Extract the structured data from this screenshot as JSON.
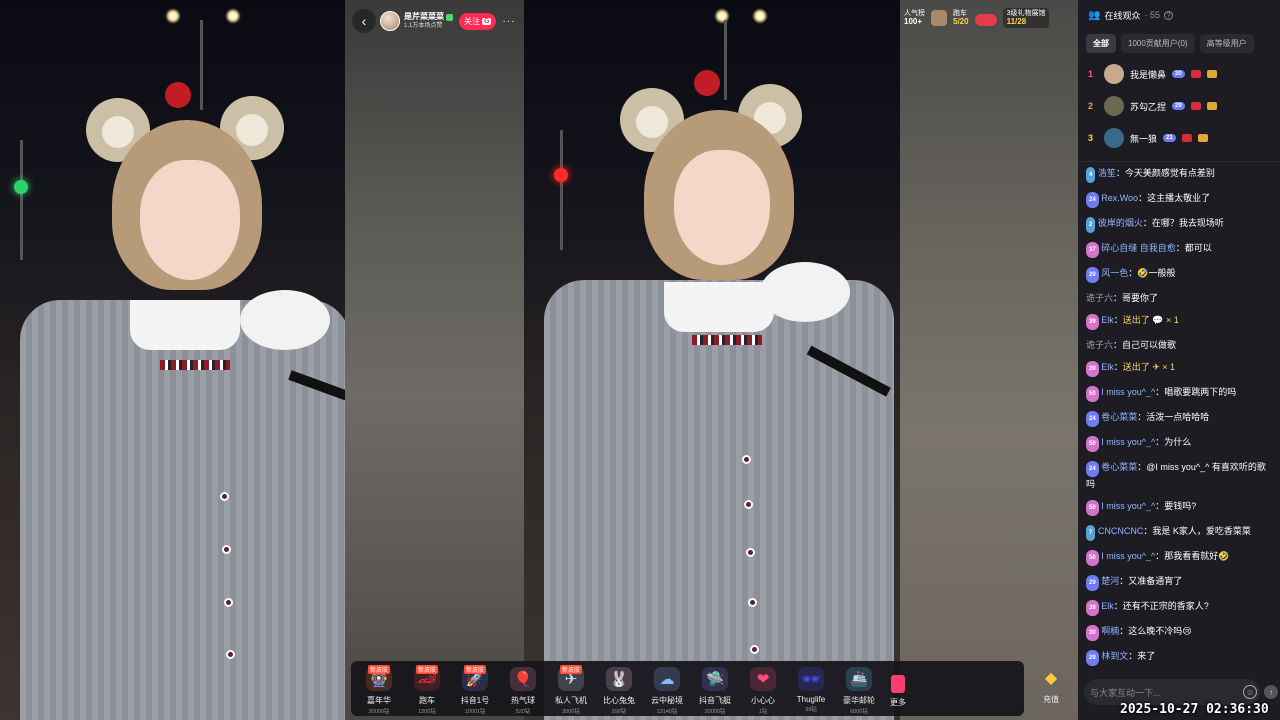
{
  "header": {
    "host_name": "是芹菜菜菜",
    "host_subtitle": "1.1万本场点赞",
    "follow_label": "关注",
    "follow_badge": "G"
  },
  "stats": {
    "popularity_label": "人气榜",
    "popularity_value": "100+",
    "car_label": "跑车",
    "car_value": "5/20",
    "rank_label": "3级礼物展馆",
    "rank_value": "11/28"
  },
  "gifts": [
    {
      "name": "嘉年华",
      "price": "30000钻",
      "badge": "新皮肤",
      "icon": "🎡",
      "color": "#ff7a3d"
    },
    {
      "name": "跑车",
      "price": "1200钻",
      "badge": "新皮肤",
      "icon": "🏎",
      "color": "#e83a44"
    },
    {
      "name": "抖音1号",
      "price": "10001钻",
      "badge": "新皮肤",
      "icon": "🚀",
      "color": "#6e7cff"
    },
    {
      "name": "热气球",
      "price": "520钻",
      "badge": "",
      "icon": "🎈",
      "color": "#ff8fbf"
    },
    {
      "name": "私人飞机",
      "price": "3000钻",
      "badge": "新皮肤",
      "icon": "✈",
      "color": "#d0d6e8"
    },
    {
      "name": "比心兔兔",
      "price": "299钻",
      "badge": "",
      "icon": "🐰",
      "color": "#f2c8e6"
    },
    {
      "name": "云中秘境",
      "price": "13140钻",
      "badge": "",
      "icon": "☁",
      "color": "#8ab8ff"
    },
    {
      "name": "抖音飞艇",
      "price": "20000钻",
      "badge": "",
      "icon": "🛸",
      "color": "#7b7fff"
    },
    {
      "name": "小心心",
      "price": "1钻",
      "badge": "",
      "icon": "❤",
      "color": "#ff4d7a"
    },
    {
      "name": "Thuglife",
      "price": "99钻",
      "badge": "",
      "icon": "🕶",
      "color": "#4a4aff"
    },
    {
      "name": "豪华邮轮",
      "price": "6000钻",
      "badge": "",
      "icon": "🚢",
      "color": "#5ec7ff"
    }
  ],
  "gifts_more_label": "更多",
  "recharge_label": "充值",
  "panel": {
    "title": "在线观众",
    "count": "· 55",
    "tabs": [
      "全部",
      "1000贡献用户(0)",
      "高等级用户"
    ],
    "top3": [
      {
        "rank": "1",
        "name": "我是懒鼻",
        "level": "30",
        "rank_color": "#ff5b6e",
        "avatar": "#c8a98c"
      },
      {
        "rank": "2",
        "name": "苏勾乙捏",
        "level": "29",
        "rank_color": "#ff9a3c",
        "avatar": "#6a6a52"
      },
      {
        "rank": "3",
        "name": "無一狼",
        "level": "21",
        "rank_color": "#ffd24a",
        "avatar": "#3a6b8a"
      }
    ],
    "chat": [
      {
        "level": "4",
        "name": "浩笙",
        "text": "今天美颜感觉有点差别"
      },
      {
        "level": "24",
        "name": "Rex.Woo",
        "text": "这主播太敬业了"
      },
      {
        "level": "2",
        "name": "彼岸的烟火",
        "text": "在哪？我去现场听"
      },
      {
        "level": "37",
        "name": "碎心自缝 自我自愈",
        "text": "都可以"
      },
      {
        "level": "29",
        "name": "风一色",
        "text": "🤣一般般"
      },
      {
        "level": "",
        "name": "诡子六",
        "text": "哥要你了"
      },
      {
        "level": "39",
        "name": "Elk",
        "text": "送出了 💬 × 1",
        "gift": true
      },
      {
        "level": "",
        "name": "诡子六",
        "text": "自己可以做歌"
      },
      {
        "level": "39",
        "name": "Elk",
        "text": "送出了 ✈ × 1",
        "gift": true
      },
      {
        "level": "50",
        "name": "I miss you^_^",
        "text": "唱歌要跳两下的吗"
      },
      {
        "level": "24",
        "name": "卷心菜菜",
        "text": "活泼一点哈哈哈"
      },
      {
        "level": "50",
        "name": "I miss you^_^",
        "text": "为什么"
      },
      {
        "level": "24",
        "name": "卷心菜菜",
        "text": "@I miss you^_^ 有喜欢听的歌吗"
      },
      {
        "level": "50",
        "name": "I miss you^_^",
        "text": "要钱吗?"
      },
      {
        "level": "7",
        "name": "CNCNCNC",
        "text": "我是 K家人，爱吃香菜菜"
      },
      {
        "level": "50",
        "name": "I miss you^_^",
        "text": "那我看看就好🤣"
      },
      {
        "level": "29",
        "name": "楚河",
        "text": "又准备通宵了"
      },
      {
        "level": "39",
        "name": "Elk",
        "text": "还有不正宗的香家人?"
      },
      {
        "level": "30",
        "name": "啊楠",
        "text": "这么晚不冷吗😢"
      },
      {
        "level": "29",
        "name": "林到文",
        "text": "来了"
      }
    ],
    "input_placeholder": "与大家互动一下..."
  },
  "timestamp": "2025-10-27 02:36:30"
}
